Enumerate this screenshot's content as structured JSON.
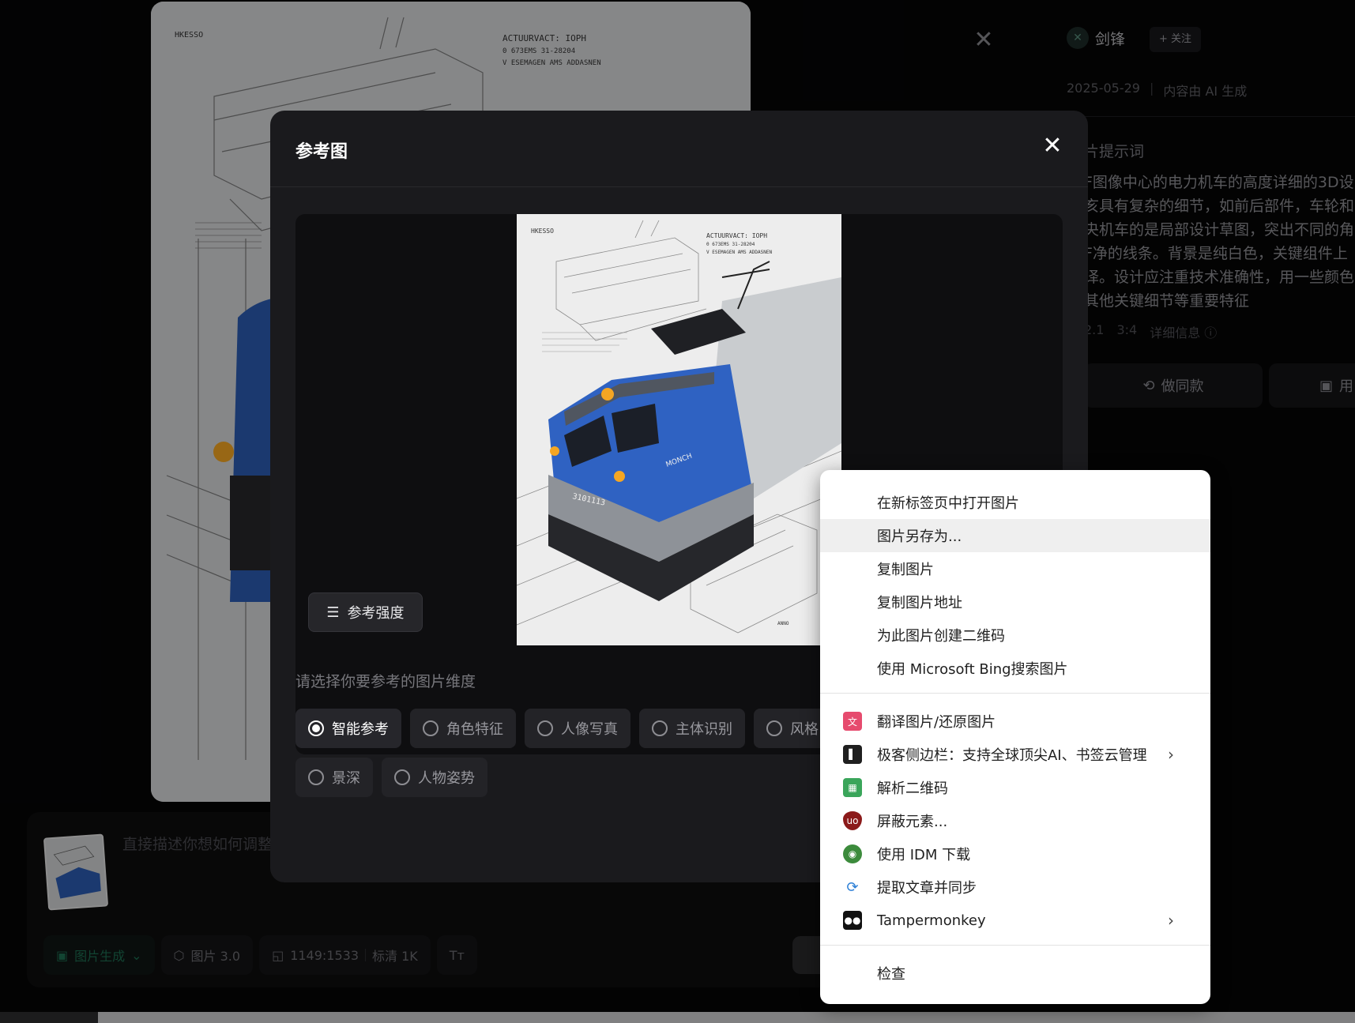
{
  "background": {
    "image_text": {
      "top_left": "HKESSO",
      "top_right_1": "ACTUURVACT: IOPH",
      "top_right_2": "0 673EMS 31-28204",
      "top_right_3": "V ESEMAGEN AMS ADDASNEN"
    },
    "author": {
      "name": "剑锋",
      "avatar_glyph": "✕",
      "follow_label": "+ 关注"
    },
    "meta": {
      "date": "2025-05-29",
      "note": "内容由 AI 生成"
    },
    "prompt": {
      "title": "片提示词",
      "lines": [
        "F图像中心的电力机车的高度详细的3D设",
        "亥具有复杂的细节，如前后部件，车轮和",
        "央机车的是局部设计草图，突出不同的角",
        "F净的线条。背景是纯白色，关键组件上",
        "译。设计应注重技术准确性，用一些颜色",
        "其他关键细节等重要特征"
      ]
    },
    "info": {
      "model": "2.1",
      "ratio": "3:4",
      "details": "详细信息 ⓘ"
    },
    "buttons": {
      "same_style": "做同款",
      "use": "用"
    },
    "input": {
      "placeholder": "直接描述你想如何调整",
      "chips": {
        "generate": "图片生成",
        "model": "图片 3.0",
        "ratio": "1149:1533",
        "quality": "标清 1K",
        "text_tool": "Tт"
      }
    }
  },
  "modal": {
    "title": "参考图",
    "close_glyph": "✕",
    "strength_button": "参考强度",
    "dimension_label": "请选择你要参考的图片维度",
    "options_row1": [
      "智能参考",
      "角色特征",
      "人像写真",
      "主体识别",
      "风格"
    ],
    "options_row2": [
      "景深",
      "人物姿势"
    ],
    "selected_option": "智能参考",
    "preview_text": {
      "top_left": "HKESSO",
      "top_right_1": "ACTUURVACT: IOPH",
      "top_right_2": "0 673EMS 31-28204",
      "top_right_3": "V ESEMAGEN AMS ADDASNEN",
      "loco_name": "MONCH",
      "loco_number": "3101113",
      "sketch_label": "ANNO"
    }
  },
  "context_menu": {
    "group1": [
      "在新标签页中打开图片",
      "图片另存为...",
      "复制图片",
      "复制图片地址",
      "为此图片创建二维码",
      "使用 Microsoft Bing搜索图片"
    ],
    "group2": [
      {
        "label": "翻译图片/还原图片",
        "icon": "translate-icon",
        "color": "#e64b6e",
        "submenu": false
      },
      {
        "label": "极客侧边栏：支持全球顶尖AI、书签云管理",
        "icon": "sidebar-icon",
        "color": "#1f1f1f",
        "submenu": true
      },
      {
        "label": "解析二维码",
        "icon": "qrcode-icon",
        "color": "#3aa55a",
        "submenu": false
      },
      {
        "label": "屏蔽元素...",
        "icon": "ublock-icon",
        "color": "#8b1a1a",
        "submenu": false
      },
      {
        "label": "使用 IDM 下载",
        "icon": "idm-icon",
        "color": "#3c8b3c",
        "submenu": false
      },
      {
        "label": "提取文章并同步",
        "icon": "sync-icon",
        "color": "#2c7fd6",
        "submenu": false
      },
      {
        "label": "Tampermonkey",
        "icon": "tampermonkey-icon",
        "color": "#111111",
        "submenu": true
      }
    ],
    "group3": [
      "检查"
    ],
    "highlighted": "图片另存为..."
  }
}
